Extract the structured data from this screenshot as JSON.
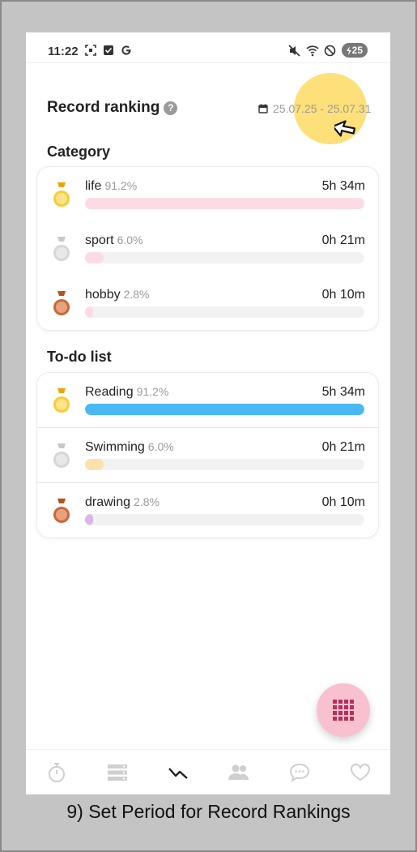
{
  "status_bar": {
    "time": "11:22",
    "battery": "25"
  },
  "header": {
    "title": "Record ranking",
    "help": "?",
    "date_range": "25.07.25 - 25.07.31"
  },
  "category": {
    "title": "Category",
    "items": [
      {
        "name": "life",
        "pct": "91.2%",
        "time": "5h 34m",
        "fill": 1.0,
        "color": "#fbdbe4",
        "medal": "gold"
      },
      {
        "name": "sport",
        "pct": "6.0%",
        "time": "0h 21m",
        "fill": 0.066,
        "color": "#fbdbe4",
        "medal": "silver"
      },
      {
        "name": "hobby",
        "pct": "2.8%",
        "time": "0h 10m",
        "fill": 0.03,
        "color": "#fbdbe4",
        "medal": "bronze"
      }
    ]
  },
  "todo": {
    "title": "To-do list",
    "items": [
      {
        "name": "Reading",
        "pct": "91.2%",
        "time": "5h 34m",
        "fill": 1.0,
        "color": "#4ab8f5",
        "medal": "gold"
      },
      {
        "name": "Swimming",
        "pct": "6.0%",
        "time": "0h 21m",
        "fill": 0.066,
        "color": "#fde1ad",
        "medal": "silver"
      },
      {
        "name": "drawing",
        "pct": "2.8%",
        "time": "0h 10m",
        "fill": 0.03,
        "color": "#d9b8e8",
        "medal": "bronze"
      }
    ]
  },
  "nav": {
    "items": [
      "timer-icon",
      "list-icon",
      "stats-icon",
      "friends-icon",
      "chat-icon",
      "heart-icon"
    ]
  },
  "caption": "9) Set Period for Record Rankings"
}
